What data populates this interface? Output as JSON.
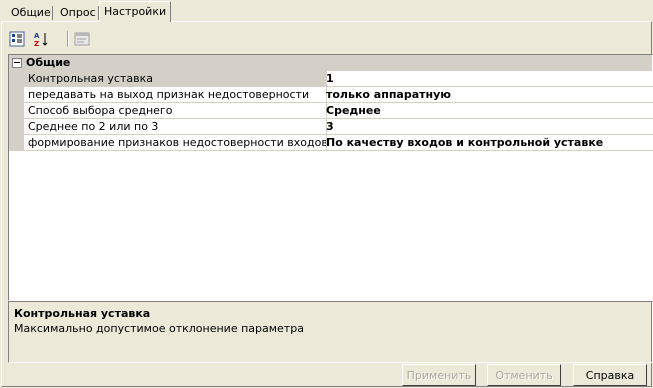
{
  "tabs": [
    {
      "label": "Общие",
      "active": false
    },
    {
      "label": "Опрос",
      "active": false
    },
    {
      "label": "Настройки",
      "active": true
    }
  ],
  "toolbar": {
    "categorized_icon": "categorized-view-icon",
    "alphabetical_icon": "sort-alphabetical-icon",
    "pages_icon": "property-pages-icon"
  },
  "grid": {
    "category": "Общие",
    "rows": [
      {
        "name": "Контрольная уставка",
        "value": "1"
      },
      {
        "name": "передавать на выход признак недостоверности",
        "value": "только аппаратную"
      },
      {
        "name": "Способ выбора среднего",
        "value": "Среднее"
      },
      {
        "name": "Среднее по 2 или по 3",
        "value": "3"
      },
      {
        "name": "формирование признаков недостоверности входов",
        "value": "По качеству входов и контрольной уставке"
      }
    ]
  },
  "description": {
    "title": "Контрольная уставка",
    "text": "Максимально допустимое отклонение параметра"
  },
  "buttons": {
    "apply": "Применить",
    "cancel": "Отменить",
    "help": "Справка"
  }
}
